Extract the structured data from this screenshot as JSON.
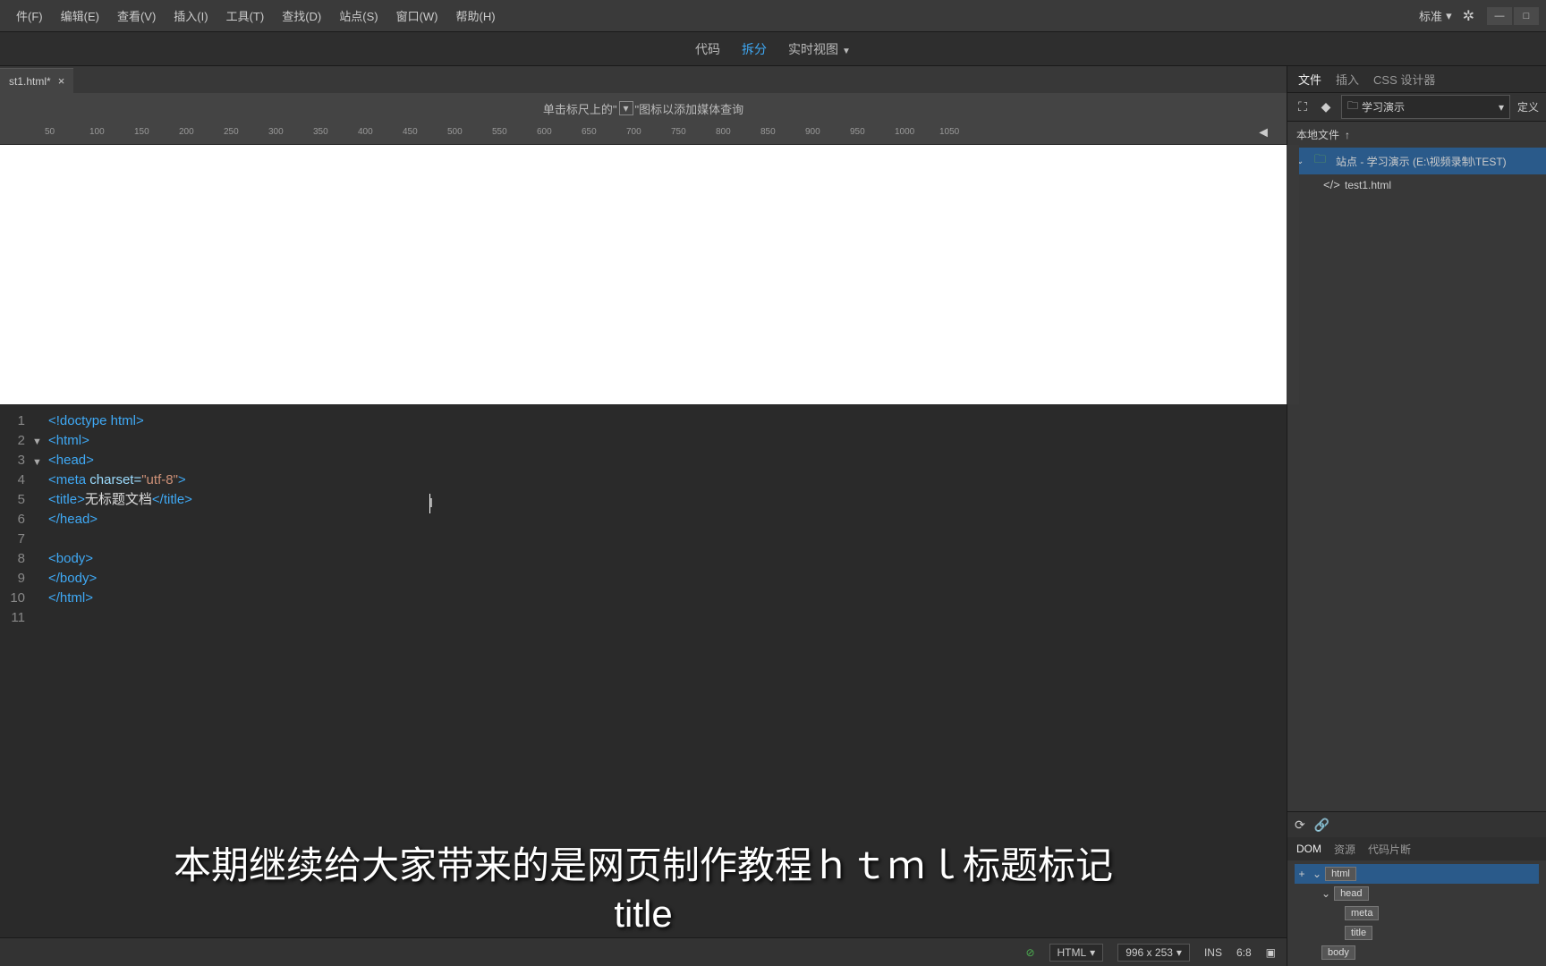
{
  "menubar": {
    "items": [
      "件(F)",
      "编辑(E)",
      "查看(V)",
      "插入(I)",
      "工具(T)",
      "查找(D)",
      "站点(S)",
      "窗口(W)",
      "帮助(H)"
    ],
    "workspace": "标准"
  },
  "view_tabs": {
    "items": [
      {
        "label": "代码",
        "active": false
      },
      {
        "label": "拆分",
        "active": true
      },
      {
        "label": "实时视图",
        "active": false,
        "has_caret": true
      }
    ]
  },
  "file_tab": {
    "name": "st1.html*"
  },
  "ruler_hint": {
    "prefix": "单击标尺上的\"",
    "suffix": "\"图标以添加媒体查询"
  },
  "ruler_ticks": [
    50,
    100,
    150,
    200,
    250,
    300,
    350,
    400,
    450,
    500,
    550,
    600,
    650,
    700,
    750,
    800,
    850,
    900,
    950,
    1000,
    1050
  ],
  "code": {
    "lines": [
      {
        "n": 1,
        "fold": "",
        "html": "<span class='c-doc'>&lt;!doctype html&gt;</span>"
      },
      {
        "n": 2,
        "fold": "▼",
        "html": "<span class='c-tag'>&lt;html&gt;</span>"
      },
      {
        "n": 3,
        "fold": "▼",
        "html": "<span class='c-tag'>&lt;head&gt;</span>"
      },
      {
        "n": 4,
        "fold": "",
        "html": "<span class='c-tag'>&lt;meta</span> <span class='c-attr'>charset=</span><span class='c-str'>\"utf-8\"</span><span class='c-tag'>&gt;</span>"
      },
      {
        "n": 5,
        "fold": "",
        "html": "<span class='c-tag'>&lt;title&gt;</span><span class='c-txt'>无标题文档</span><span class='c-tag'>&lt;/title&gt;</span>"
      },
      {
        "n": 6,
        "fold": "",
        "html": "<span class='c-tag'>&lt;/head&gt;</span>"
      },
      {
        "n": 7,
        "fold": "",
        "html": ""
      },
      {
        "n": 8,
        "fold": "",
        "html": "<span class='c-tag'>&lt;body&gt;</span>"
      },
      {
        "n": 9,
        "fold": "",
        "html": "<span class='c-tag'>&lt;/body&gt;</span>"
      },
      {
        "n": 10,
        "fold": "",
        "html": "<span class='c-tag'>&lt;/html&gt;</span>"
      },
      {
        "n": 11,
        "fold": "",
        "html": ""
      }
    ]
  },
  "right_panel": {
    "tabs": [
      {
        "label": "文件",
        "active": true
      },
      {
        "label": "插入",
        "active": false
      },
      {
        "label": "CSS 设计器",
        "active": false
      }
    ],
    "site_select": "学习演示",
    "define_btn": "定义",
    "local_files_header": "本地文件",
    "tree": {
      "root": "站点 - 学习演示 (E:\\视频录制\\TEST)",
      "child": "test1.html"
    }
  },
  "dom_panel": {
    "tabs": [
      {
        "label": "DOM",
        "active": true
      },
      {
        "label": "资源",
        "active": false
      },
      {
        "label": "代码片断",
        "active": false
      }
    ],
    "nodes": [
      "html",
      "head",
      "meta",
      "title",
      "body"
    ]
  },
  "statusbar": {
    "lang": "HTML",
    "dims": "996 x 253",
    "ins": "INS",
    "pos": "6:8"
  },
  "subtitle": {
    "line1": "本期继续给大家带来的是网页制作教程ｈｔｍｌ标题标记",
    "line2": "title"
  }
}
